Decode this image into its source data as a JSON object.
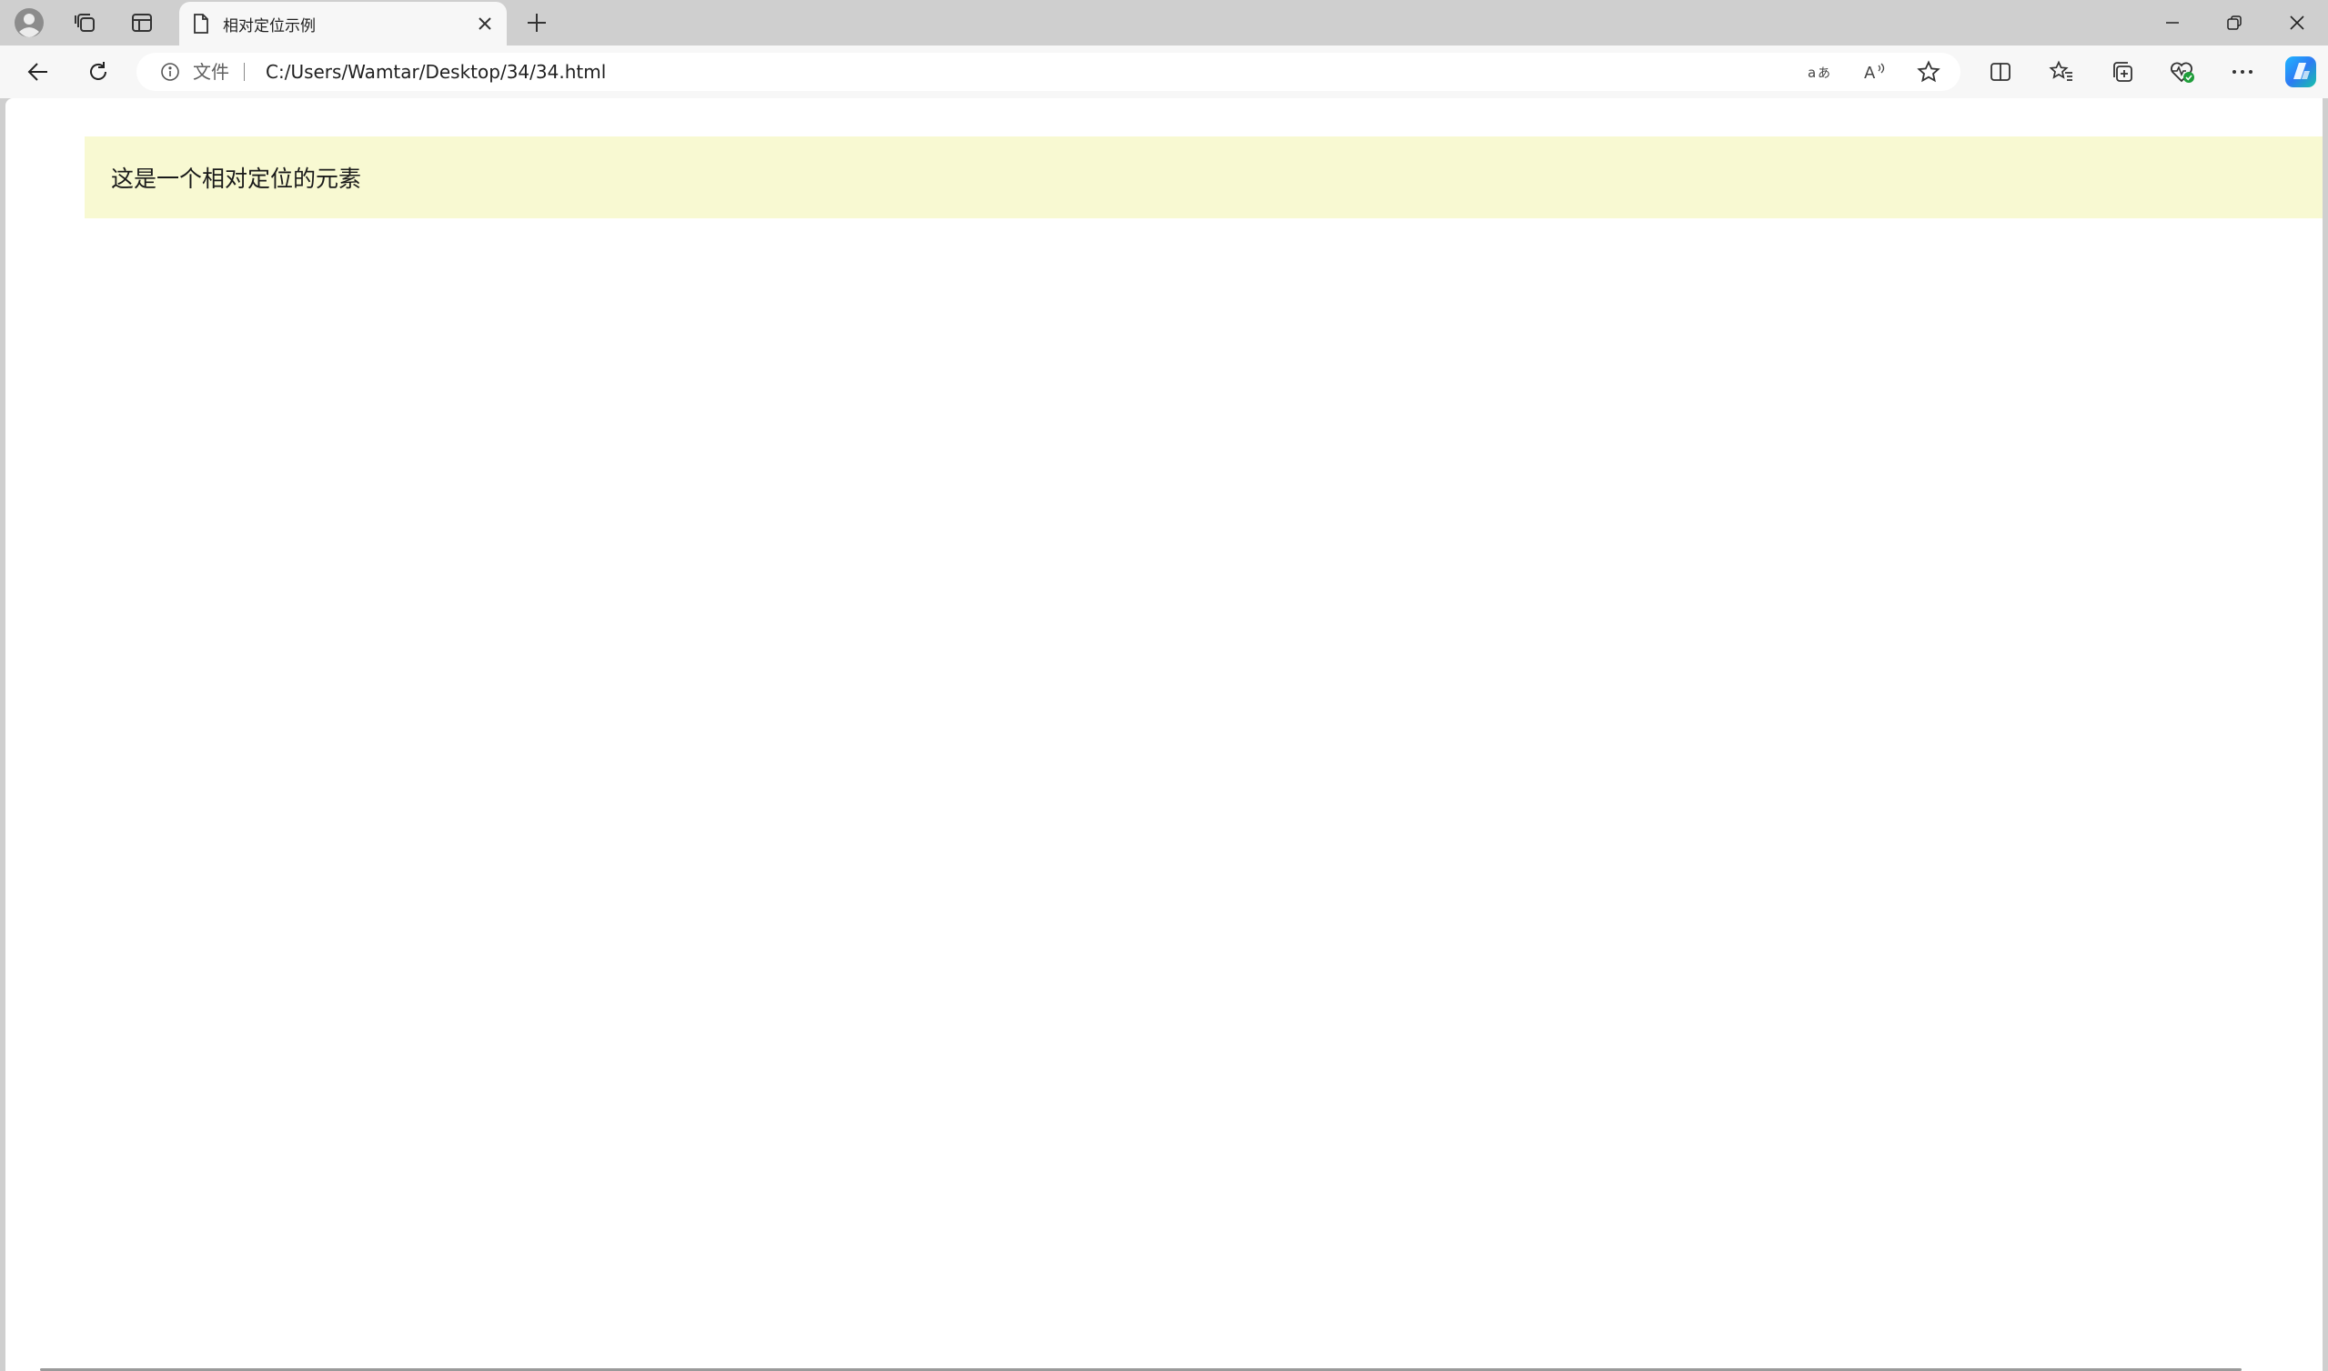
{
  "tab": {
    "title": "相对定位示例"
  },
  "address_bar": {
    "info_label": "文件",
    "url": "C:/Users/Wamtar/Desktop/34/34.html"
  },
  "page": {
    "relative_element_text": "这是一个相对定位的元素",
    "box_color": "#f8f9d2"
  },
  "icons": [
    "profile-icon",
    "workspaces-icon",
    "vertical-tabs-icon",
    "page-icon",
    "close-icon",
    "new-tab-icon",
    "minimize-icon",
    "restore-icon",
    "window-close-icon",
    "back-icon",
    "refresh-icon",
    "info-icon",
    "translate-icon",
    "read-aloud-icon",
    "favorite-star-icon",
    "split-screen-icon",
    "favorites-icon",
    "collections-icon",
    "browser-essentials-icon",
    "more-icon",
    "copilot-icon"
  ]
}
